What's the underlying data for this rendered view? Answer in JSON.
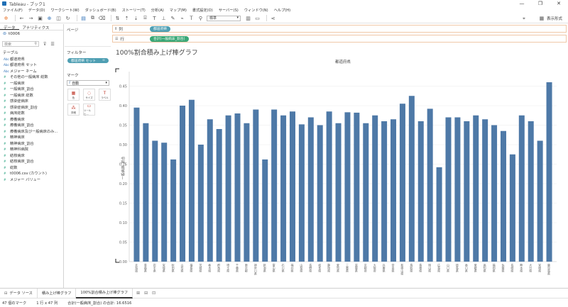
{
  "window": {
    "title": "Tableau - ブック1",
    "controls": [
      "—",
      "❐",
      "✕"
    ]
  },
  "menu": [
    "ファイル(F)",
    "データ(D)",
    "ワークシート(W)",
    "ダッシュボード(B)",
    "ストーリー(T)",
    "分析(A)",
    "マップ(M)",
    "書式設定(O)",
    "サーバー(S)",
    "ウィンドウ(N)",
    "ヘルプ(H)"
  ],
  "toolbar": {
    "fit_select": "標準",
    "show_me": "表示形式"
  },
  "left_pane": {
    "tabs": [
      "データ",
      "アナリティクス"
    ],
    "datasource": "t0006",
    "search_placeholder": "検索",
    "section": "テーブル",
    "fields": [
      {
        "type": "Abc",
        "measure": false,
        "name": "都道府県"
      },
      {
        "type": "Abc",
        "measure": false,
        "name": "都道府県 セット"
      },
      {
        "type": "Abc",
        "measure": false,
        "name": "メジャー ネーム"
      },
      {
        "type": "#",
        "measure": true,
        "name": "その他の一般病床 総数"
      },
      {
        "type": "#",
        "measure": true,
        "name": "一般病床"
      },
      {
        "type": "#",
        "measure": true,
        "name": "一般病床_割合"
      },
      {
        "type": "#",
        "measure": true,
        "name": "一般病床 総数"
      },
      {
        "type": "#",
        "measure": true,
        "name": "感染症病床"
      },
      {
        "type": "#",
        "measure": true,
        "name": "感染症病床_割合"
      },
      {
        "type": "#",
        "measure": true,
        "name": "病床総数"
      },
      {
        "type": "#",
        "measure": true,
        "name": "療養病床"
      },
      {
        "type": "#",
        "measure": true,
        "name": "療養病床_割合"
      },
      {
        "type": "#",
        "measure": true,
        "name": "療養病床及び一般病床のみ..."
      },
      {
        "type": "#",
        "measure": true,
        "name": "精神病床"
      },
      {
        "type": "#",
        "measure": true,
        "name": "精神病床_割合"
      },
      {
        "type": "#",
        "measure": true,
        "name": "精神科病院"
      },
      {
        "type": "#",
        "measure": true,
        "name": "結核病床"
      },
      {
        "type": "#",
        "measure": true,
        "name": "結核病床_割合"
      },
      {
        "type": "#",
        "measure": true,
        "name": "総数"
      },
      {
        "type": "#",
        "measure": true,
        "name": "t0006.csv (カウント)"
      },
      {
        "type": "#",
        "measure": true,
        "name": "メジャー バリュー"
      }
    ]
  },
  "cards": {
    "pages": "ページ",
    "filters": "フィルター",
    "filter_pill": "都道府県 セット",
    "filter_pill_icon": "∞",
    "marks": "マーク",
    "mark_type": "自動",
    "mark_buttons": [
      {
        "glyph": "▦",
        "label": "色"
      },
      {
        "glyph": "◌",
        "label": "サイズ"
      },
      {
        "glyph": "T",
        "label": "ラベル"
      },
      {
        "glyph": "⁂",
        "label": "詳細"
      },
      {
        "glyph": "▭",
        "label": "ツールヒ..."
      }
    ]
  },
  "shelves": {
    "columns_label": "列",
    "columns_pill": "都道府県",
    "rows_label": "行",
    "rows_pill": "合計(一般病床_割合)"
  },
  "chart_data": {
    "type": "bar",
    "title": "100%割合積み上げ棒グラフ",
    "header": "都道府県",
    "ylabel": "一般病床_割合",
    "ylim": [
      0,
      0.48
    ],
    "yticks": [
      0.0,
      0.05,
      0.1,
      0.15,
      0.2,
      0.25,
      0.3,
      0.35,
      0.4,
      0.45
    ],
    "ytick_labels": [
      "0.00",
      "0.05",
      "0.10",
      "0.15",
      "0.20",
      "0.25",
      "0.30",
      "0.35",
      "0.40",
      "0.45"
    ],
    "bar_color": "#4e79a7",
    "categories": [
      "北海道",
      "青森県",
      "岩手県",
      "宮城県",
      "秋田県",
      "山形県",
      "福島県",
      "茨城県",
      "栃木県",
      "群馬県",
      "埼玉県",
      "千葉県",
      "東京都",
      "神奈川県",
      "新潟県",
      "富山県",
      "石川県",
      "福井県",
      "山梨県",
      "長野県",
      "岐阜県",
      "静岡県",
      "愛知県",
      "三重県",
      "滋賀県",
      "京都府",
      "大阪府",
      "兵庫県",
      "奈良県",
      "和歌山県",
      "鳥取県",
      "島根県",
      "岡山県",
      "広島県",
      "山口県",
      "徳島県",
      "香川県",
      "愛媛県",
      "高知県",
      "福岡県",
      "佐賀県",
      "長崎県",
      "熊本県",
      "大分県",
      "宮崎県",
      "鹿児島県",
      "沖縄県"
    ],
    "values": [
      0.395,
      0.355,
      0.31,
      0.305,
      0.262,
      0.4,
      0.415,
      0.3,
      0.365,
      0.34,
      0.375,
      0.38,
      0.355,
      0.39,
      0.262,
      0.39,
      0.375,
      0.385,
      0.352,
      0.37,
      0.35,
      0.385,
      0.355,
      0.383,
      0.382,
      0.355,
      0.375,
      0.36,
      0.365,
      0.405,
      0.425,
      0.36,
      0.392,
      0.242,
      0.37,
      0.37,
      0.36,
      0.375,
      0.365,
      0.35,
      0.335,
      0.275,
      0.375,
      0.36,
      0.31,
      0.46
    ],
    "xtick_labels": [
      "北海道",
      "青森県",
      "岩手県",
      "宮城県",
      "秋田県",
      "山形県",
      "福島県",
      "茨城県",
      "栃木県",
      "群馬県",
      "埼玉県",
      "千葉県",
      "東京都",
      "神奈川県",
      "新潟県",
      "富山県",
      "石川県",
      "福井県",
      "山梨県",
      "長野県",
      "岐阜県",
      "静岡県",
      "愛知県",
      "三重県",
      "滋賀県",
      "京都府",
      "大阪府",
      "兵庫県",
      "奈良県",
      "和歌山県",
      "鳥取県",
      "島根県",
      "岡山県",
      "広島県",
      "山口県",
      "徳島県",
      "香川県",
      "愛媛県",
      "高知県",
      "福岡県",
      "佐賀県",
      "長崎県",
      "熊本県",
      "大分県",
      "宮崎県",
      "鹿児島県"
    ]
  },
  "sheet_tabs": [
    {
      "icon": "⊟",
      "label": "データ ソース",
      "active": false
    },
    {
      "icon": "",
      "label": "積み上げ棒グラフ",
      "active": false
    },
    {
      "icon": "",
      "label": "100%割合積み上げ棒グラフ",
      "active": true
    }
  ],
  "status": {
    "marks": "47 個のマーク",
    "rows_cols": "1 行 x 47 列",
    "sum": "合計(一般病床_割合) の合計: 16.6516"
  }
}
